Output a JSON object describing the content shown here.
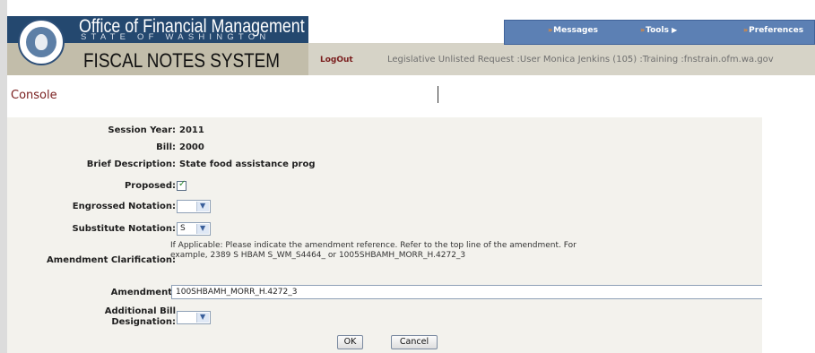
{
  "header": {
    "office_title": "Office of Financial Management",
    "office_subtitle": "STATE OF WASHINGTON",
    "system_title": "FISCAL NOTES SYSTEM",
    "logout_label": "LogOut",
    "user_info": "Legislative Unlisted Request :User Monica Jenkins (105) :Training :fnstrain.ofm.wa.gov",
    "menu": [
      {
        "label": "Messages"
      },
      {
        "label": "Tools"
      },
      {
        "label": "Preferences"
      }
    ]
  },
  "console": {
    "title": "Console"
  },
  "form": {
    "session_year_label": "Session Year:",
    "session_year_value": "2011",
    "bill_label": "Bill:",
    "bill_value": "2000",
    "brief_description_label": "Brief Description:",
    "brief_description_value": "State food assistance prog",
    "proposed_label": "Proposed:",
    "proposed_checked": true,
    "engrossed_label": "Engrossed Notation:",
    "engrossed_value": "",
    "substitute_label": "Substitute Notation:",
    "substitute_value": "S",
    "amendment_clarification_label": "Amendment Clarification:",
    "amendment_clarification_help": "If Applicable: Please indicate the amendment reference. Refer to the top line of the amendment. For example, 2389 S HBAM S_WM_S4464_ or 1005SHBAMH_MORR_H.4272_3",
    "amendment_label": "Amendment:",
    "amendment_value": "100SHBAMH_MORR_H.4272_3",
    "additional_bill_label_line1": "Additional Bill",
    "additional_bill_label_line2": "Designation:",
    "additional_bill_value": "",
    "ok_label": "OK",
    "cancel_label": "Cancel"
  },
  "colors": {
    "header_blue": "#24486f",
    "menu_blue": "#5c80b4",
    "console_red": "#7a2020",
    "panel_bg": "#f3f2ed"
  }
}
